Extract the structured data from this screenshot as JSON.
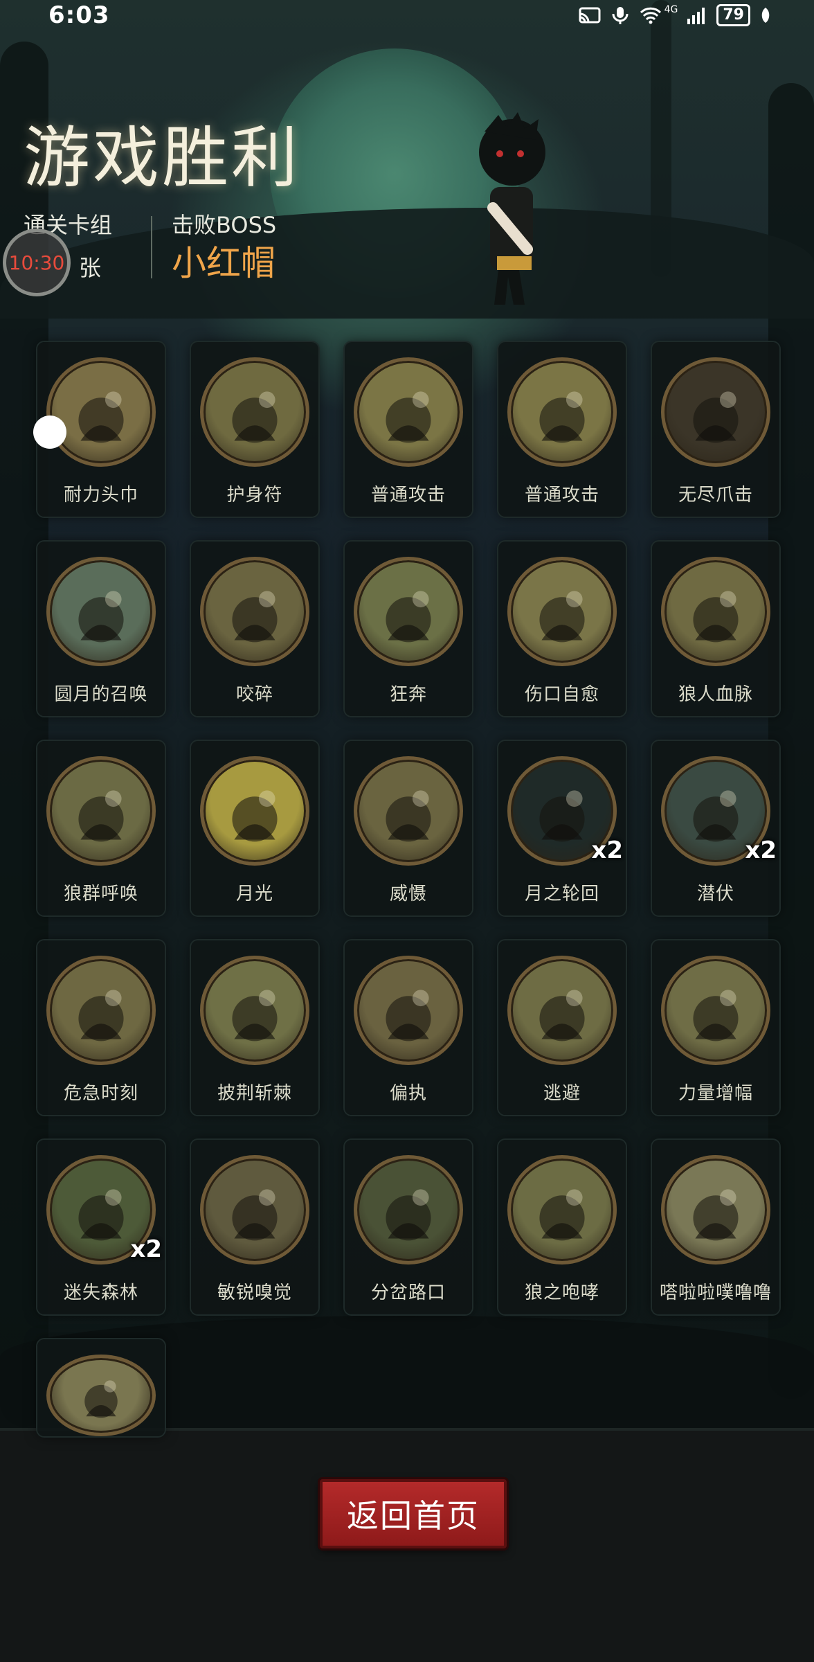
{
  "status_bar": {
    "time": "6:03",
    "network": "4G",
    "battery": "79",
    "icons": [
      "cast-icon",
      "mic-icon",
      "wifi-icon",
      "signal-icon",
      "battery-icon",
      "leaf-icon"
    ]
  },
  "header": {
    "title": "游戏胜利",
    "cards_label": "通关卡组",
    "cards_unit": "张",
    "boss_label": "击败BOSS",
    "boss_name": "小红帽",
    "timer": "10:30"
  },
  "cards": [
    {
      "name": "耐力头巾",
      "badge": "",
      "icon": "bandana-icon",
      "tone": "#7a6e45"
    },
    {
      "name": "护身符",
      "badge": "",
      "icon": "amulet-icon",
      "tone": "#6f6a40"
    },
    {
      "name": "普通攻击",
      "badge": "",
      "icon": "axe-slash-icon",
      "tone": "#7b7545"
    },
    {
      "name": "普通攻击",
      "badge": "",
      "icon": "axe-slash-icon",
      "tone": "#7b7545"
    },
    {
      "name": "无尽爪击",
      "badge": "",
      "icon": "claw-icon",
      "tone": "#3b3528"
    },
    {
      "name": "圆月的召唤",
      "badge": "",
      "icon": "full-moon-icon",
      "tone": "#5a6d5a"
    },
    {
      "name": "咬碎",
      "badge": "",
      "icon": "bite-icon",
      "tone": "#6a6440"
    },
    {
      "name": "狂奔",
      "badge": "",
      "icon": "running-wolf-icon",
      "tone": "#6b7046"
    },
    {
      "name": "伤口自愈",
      "badge": "",
      "icon": "heal-wound-icon",
      "tone": "#7a7548"
    },
    {
      "name": "狼人血脉",
      "badge": "",
      "icon": "werewolf-hand-icon",
      "tone": "#6f6a42"
    },
    {
      "name": "狼群呼唤",
      "badge": "",
      "icon": "wolf-pack-icon",
      "tone": "#6b6a44"
    },
    {
      "name": "月光",
      "badge": "",
      "icon": "moonlight-icon",
      "tone": "#a79a40"
    },
    {
      "name": "威慑",
      "badge": "",
      "icon": "bear-roar-icon",
      "tone": "#6a6440"
    },
    {
      "name": "月之轮回",
      "badge": "x2",
      "icon": "moon-phases-icon",
      "tone": "#1f2a28"
    },
    {
      "name": "潜伏",
      "badge": "x2",
      "icon": "lurking-wolf-icon",
      "tone": "#3a4a42"
    },
    {
      "name": "危急时刻",
      "badge": "",
      "icon": "critical-moment-icon",
      "tone": "#6e6842"
    },
    {
      "name": "披荆斩棘",
      "badge": "",
      "icon": "thorn-axe-icon",
      "tone": "#6f7046"
    },
    {
      "name": "偏执",
      "badge": "",
      "icon": "paranoia-icon",
      "tone": "#6a6240"
    },
    {
      "name": "逃避",
      "badge": "",
      "icon": "escape-icon",
      "tone": "#6e6c44"
    },
    {
      "name": "力量增幅",
      "badge": "",
      "icon": "log-lift-icon",
      "tone": "#6f6d46"
    },
    {
      "name": "迷失森林",
      "badge": "x2",
      "icon": "lost-forest-icon",
      "tone": "#4d5a38"
    },
    {
      "name": "敏锐嗅觉",
      "badge": "",
      "icon": "keen-smell-icon",
      "tone": "#5f5a3e"
    },
    {
      "name": "分岔路口",
      "badge": "",
      "icon": "crossroad-icon",
      "tone": "#4a5236"
    },
    {
      "name": "狼之咆哮",
      "badge": "",
      "icon": "wolf-howl-icon",
      "tone": "#6c6c44"
    },
    {
      "name": "嗒啦啦噗噜噜",
      "badge": "",
      "icon": "robot-girl-icon",
      "tone": "#7a7856"
    },
    {
      "name": "",
      "badge": "",
      "icon": "armored-girl-icon",
      "tone": "#7a7650"
    }
  ],
  "buttons": {
    "home": "返回首页"
  }
}
